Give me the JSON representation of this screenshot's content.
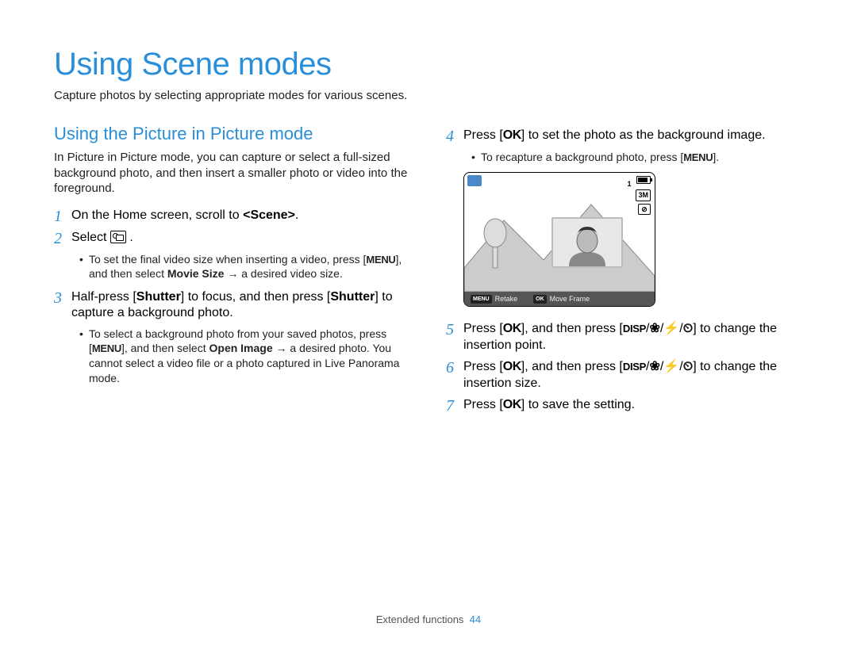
{
  "title": "Using Scene modes",
  "subtitle": "Capture photos by selecting appropriate modes for various scenes.",
  "section_heading": "Using the Picture in Picture mode",
  "section_intro": "In Picture in Picture mode, you can capture or select a full-sized background photo, and then insert a smaller photo or video into the foreground.",
  "steps": {
    "s1": {
      "num": "1",
      "text_a": "On the Home screen, scroll to ",
      "scene": "<Scene>",
      "text_b": "."
    },
    "s2": {
      "num": "2",
      "text_a": "Select ",
      "text_b": " ."
    },
    "s2_bullet": {
      "a": "To set the final video size when inserting a video, press [",
      "menu": "MENU",
      "b": "], and then select ",
      "bold": "Movie Size",
      "c": " → a desired video size."
    },
    "s3": {
      "num": "3",
      "a": "Half-press [",
      "shutter1": "Shutter",
      "b": "] to focus, and then press [",
      "shutter2": "Shutter",
      "c": "] to capture a background photo."
    },
    "s3_bullet": {
      "a": "To select a background photo from your saved photos, press [",
      "menu": "MENU",
      "b": "], and then select ",
      "bold": "Open Image",
      "c": " → a desired photo. You cannot select a video file or a photo captured in Live Panorama mode."
    },
    "s4": {
      "num": "4",
      "a": "Press [",
      "ok": "OK",
      "b": "] to set the photo as the background image."
    },
    "s4_bullet": {
      "a": "To recapture a background photo, press [",
      "menu": "MENU",
      "b": "]."
    },
    "s5": {
      "num": "5",
      "a": "Press [",
      "ok": "OK",
      "b": "], and then press [",
      "disp": "DISP",
      "slash": "/",
      "flower": "❀",
      "flash": "⚡",
      "timer": "⏲",
      "c": "] to change the insertion point."
    },
    "s6": {
      "num": "6",
      "a": "Press [",
      "ok": "OK",
      "b": "], and then press [",
      "disp": "DISP",
      "slash": "/",
      "flower": "❀",
      "flash": "⚡",
      "timer": "⏲",
      "c": "] to change the insertion size."
    },
    "s7": {
      "num": "7",
      "a": "Press [",
      "ok": "OK",
      "b": "] to save the setting."
    }
  },
  "illus": {
    "count": "1",
    "quality": "3M",
    "flash": "⊘",
    "bottom_left_tag": "MENU",
    "bottom_left_text": "Retake",
    "bottom_right_tag": "OK",
    "bottom_right_text": "Move Frame"
  },
  "footer": {
    "section": "Extended functions",
    "page": "44"
  }
}
